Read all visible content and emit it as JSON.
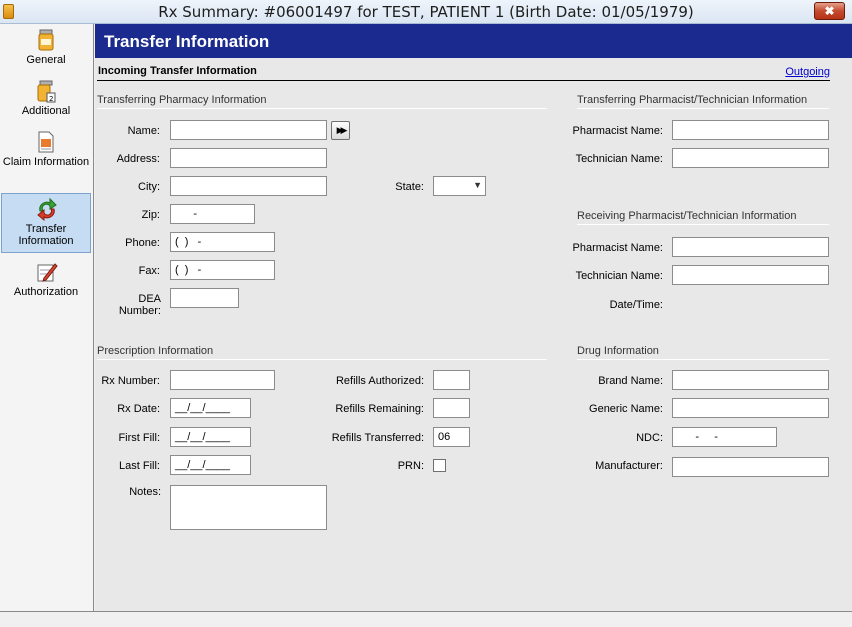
{
  "window": {
    "title": "Rx Summary: #06001497 for TEST, PATIENT 1 (Birth Date: 01/05/1979)",
    "close_symbol": "✖"
  },
  "sidebar": {
    "items": [
      {
        "label": "General",
        "icon": "pill-bottle-icon"
      },
      {
        "label": "Additional",
        "icon": "pill-bottle-2-icon"
      },
      {
        "label": "Claim Information",
        "icon": "claim-document-icon"
      },
      {
        "label": "Transfer Information",
        "icon": "transfer-arrows-icon",
        "active": true
      },
      {
        "label": "Authorization",
        "icon": "authorization-pen-icon"
      }
    ]
  },
  "header": {
    "title": "Transfer Information"
  },
  "incoming": {
    "title": "Incoming Transfer Information",
    "outgoing_link": "Outgoing"
  },
  "pharmacy": {
    "section_title": "Transferring Pharmacy Information",
    "name_label": "Name:",
    "name_value": "",
    "lookup_symbol": "▶▶",
    "address_label": "Address:",
    "address_value": "",
    "city_label": "City:",
    "city_value": "",
    "state_label": "State:",
    "state_value": "",
    "zip_label": "Zip:",
    "zip_value": "      -",
    "phone_label": "Phone:",
    "phone_value": "(  )   -",
    "fax_label": "Fax:",
    "fax_value": "(  )   -",
    "dea_label": "DEA Number:",
    "dea_value": ""
  },
  "transferring_staff": {
    "section_title": "Transferring Pharmacist/Technician Information",
    "pharmacist_label": "Pharmacist Name:",
    "pharmacist_value": "",
    "technician_label": "Technician Name:",
    "technician_value": ""
  },
  "receiving_staff": {
    "section_title": "Receiving Pharmacist/Technician Information",
    "pharmacist_label": "Pharmacist Name:",
    "pharmacist_value": "",
    "technician_label": "Technician Name:",
    "technician_value": "",
    "datetime_label": "Date/Time:"
  },
  "prescription": {
    "section_title": "Prescription Information",
    "rx_number_label": "Rx Number:",
    "rx_number_value": "",
    "rx_date_label": "Rx Date:",
    "rx_date_value": "__/__/____",
    "first_fill_label": "First Fill:",
    "first_fill_value": "__/__/____",
    "last_fill_label": "Last Fill:",
    "last_fill_value": "__/__/____",
    "notes_label": "Notes:",
    "notes_value": "",
    "refills_authorized_label": "Refills Authorized:",
    "refills_authorized_value": "",
    "refills_remaining_label": "Refills Remaining:",
    "refills_remaining_value": "",
    "refills_transferred_label": "Refills Transferred:",
    "refills_transferred_value": "06",
    "prn_label": "PRN:",
    "prn_checked": false
  },
  "drug": {
    "section_title": "Drug Information",
    "brand_label": "Brand Name:",
    "brand_value": "",
    "generic_label": "Generic Name:",
    "generic_value": "",
    "ndc_label": "NDC:",
    "ndc_value": "      -     -",
    "manufacturer_label": "Manufacturer:",
    "manufacturer_value": ""
  },
  "colors": {
    "header": "#1b2a8f",
    "active_nav": "#c5dcf3",
    "link": "#0000cc"
  }
}
